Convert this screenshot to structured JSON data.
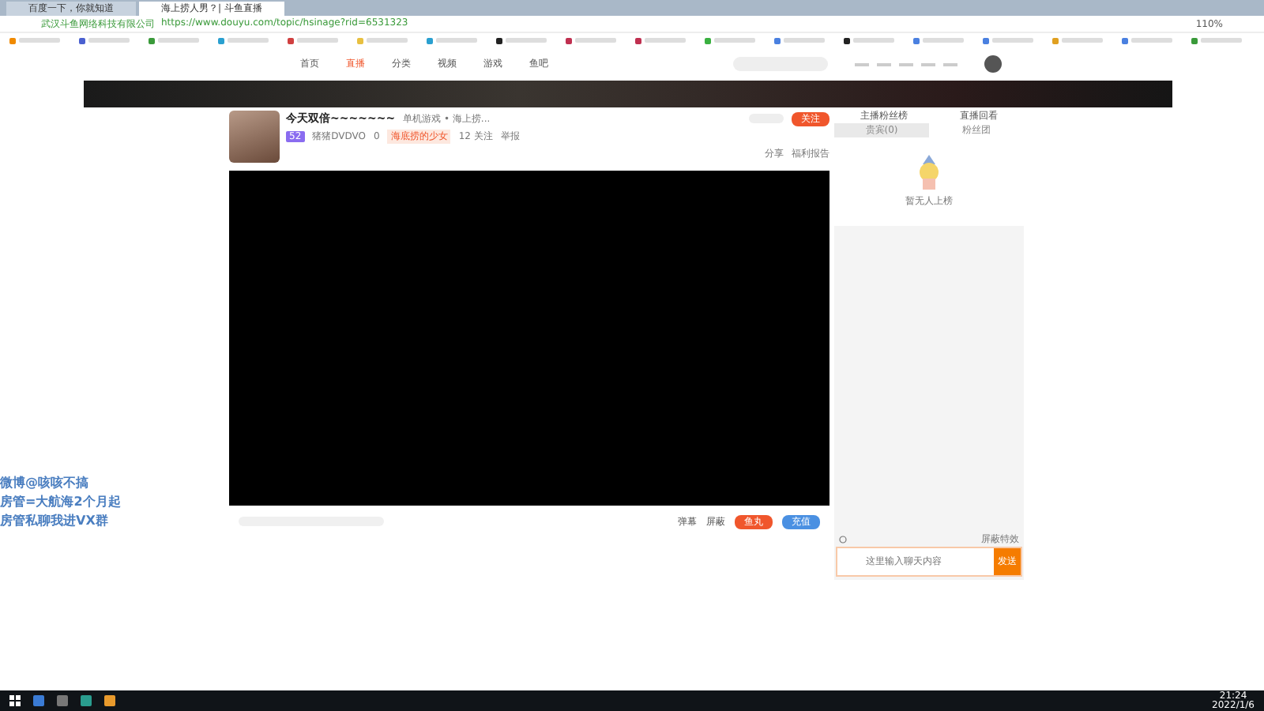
{
  "browser": {
    "tabs": [
      {
        "label": "百度一下，你就知道",
        "selected": false
      },
      {
        "label": "海上捞人男？| 斗鱼直播",
        "selected": true
      }
    ],
    "site_label": "武汉斗鱼网络科技有限公司",
    "url": "https://www.douyu.com/topic/hsinage?rid=6531323",
    "zoom": "110%"
  },
  "site_nav": {
    "items": [
      {
        "label": "首页",
        "selected": false
      },
      {
        "label": "直播",
        "selected": true
      },
      {
        "label": "分类",
        "selected": false
      },
      {
        "label": "视频",
        "selected": false
      },
      {
        "label": "游戏",
        "selected": false
      },
      {
        "label": "鱼吧",
        "selected": false
      }
    ]
  },
  "room": {
    "title": "今天双倍~~~~~~~",
    "category": "单机游戏 • 海上捞...",
    "level": "52",
    "streamer": "猪猪DVDVO",
    "heat": "0",
    "tag": "海底捞的少女",
    "viewers": "12 关注",
    "report": "举报",
    "follow": "关注",
    "share": "分享",
    "welfare": "福利报告"
  },
  "right_panel": {
    "links": [
      "主播粉丝榜",
      "直播回看"
    ],
    "tabs": [
      {
        "label": "贵宾(0)",
        "selected": true
      },
      {
        "label": "粉丝团",
        "selected": false
      }
    ],
    "empty": "暂无人上榜"
  },
  "overlay": [
    "微博@咳咳不搞",
    "房管=大航海2个月起",
    "房管私聊我进VX群"
  ],
  "player_bar": {
    "options": [
      "弹幕",
      "屏蔽"
    ],
    "buttons": [
      {
        "label": "鱼丸",
        "kind": "orange"
      },
      {
        "label": "充值",
        "kind": "blue"
      }
    ]
  },
  "chat": {
    "hide_label": "屏蔽特效",
    "placeholder": "这里输入聊天内容",
    "send": "发送"
  },
  "taskbar": {
    "time": "21:24",
    "date": "2022/1/6"
  }
}
